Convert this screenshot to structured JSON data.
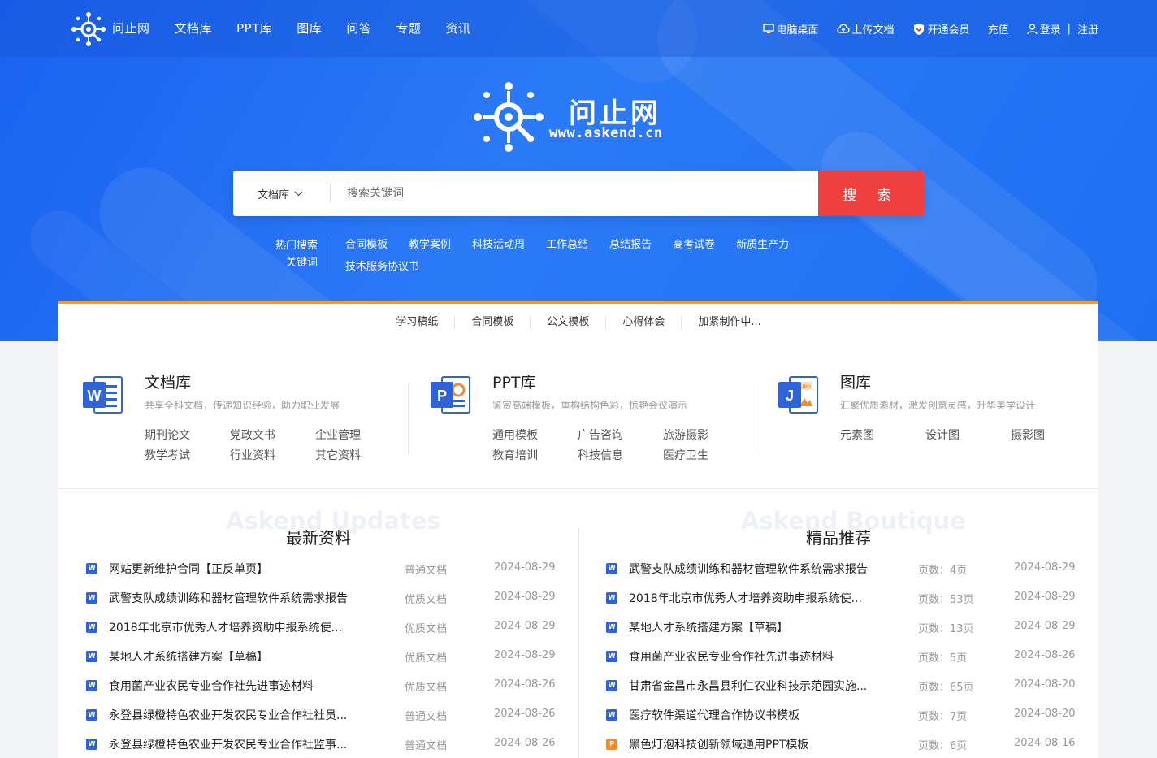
{
  "nav": {
    "brand": "问止网",
    "items": [
      "文档库",
      "PPT库",
      "图库",
      "问答",
      "专题",
      "资讯"
    ]
  },
  "top_right": {
    "desktop": "电脑桌面",
    "upload": "上传文档",
    "vip": "开通会员",
    "recharge": "充值",
    "login": "登录",
    "separator": "|",
    "register": "注册"
  },
  "brand": {
    "name": "问止网",
    "url": "www.askend.cn"
  },
  "search": {
    "scope": "文档库",
    "placeholder": "搜索关键词",
    "button": "搜 索"
  },
  "hot": {
    "label_line1": "热门搜索",
    "label_line2": "关键词",
    "keywords": [
      "合同模板",
      "教学案例",
      "科技活动周",
      "工作总结",
      "总结报告",
      "高考试卷",
      "新质生产力",
      "技术服务协议书"
    ]
  },
  "subtabs": [
    "学习稿纸",
    "合同模板",
    "公文模板",
    "心得体会",
    "加紧制作中..."
  ],
  "categories": [
    {
      "title": "文档库",
      "icon": "word-icon",
      "desc": "共享全科文档，传递知识经验，助力职业发展",
      "links": [
        "期刊论文",
        "党政文书",
        "企业管理",
        "教学考试",
        "行业资料",
        "其它资料"
      ]
    },
    {
      "title": "PPT库",
      "icon": "ppt-icon",
      "desc": "鉴赏高端模板，重构结构色彩，惊艳会议演示",
      "links": [
        "通用模板",
        "广告咨询",
        "旅游摄影",
        "教育培训",
        "科技信息",
        "医疗卫生"
      ]
    },
    {
      "title": "图库",
      "icon": "image-icon",
      "desc": "汇聚优质素材，激发创意灵感，升华美学设计",
      "links": [
        "元素图",
        "设计图",
        "摄影图"
      ]
    }
  ],
  "latest": {
    "title_bg": "Askend Updates",
    "title": "最新资料",
    "rows": [
      {
        "type": "W",
        "title": "网站更新维护合同【正反单页】",
        "kind": "普通文档",
        "date": "2024-08-29"
      },
      {
        "type": "W",
        "title": "武警支队成绩训练和器材管理软件系统需求报告",
        "kind": "优质文档",
        "date": "2024-08-29"
      },
      {
        "type": "W",
        "title": "2018年北京市优秀人才培养资助申报系统使...",
        "kind": "优质文档",
        "date": "2024-08-29"
      },
      {
        "type": "W",
        "title": "某地人才系统搭建方案【草稿】",
        "kind": "优质文档",
        "date": "2024-08-29"
      },
      {
        "type": "W",
        "title": "食用菌产业农民专业合作社先进事迹材料",
        "kind": "优质文档",
        "date": "2024-08-26"
      },
      {
        "type": "W",
        "title": "永登县绿橙特色农业开发农民专业合作社社员...",
        "kind": "普通文档",
        "date": "2024-08-26"
      },
      {
        "type": "W",
        "title": "永登县绿橙特色农业开发农民专业合作社监事...",
        "kind": "普通文档",
        "date": "2024-08-26"
      }
    ]
  },
  "boutique": {
    "title_bg": "Askend Boutique",
    "title": "精品推荐",
    "rows": [
      {
        "type": "W",
        "title": "武警支队成绩训练和器材管理软件系统需求报告",
        "pages": "页数：4页",
        "date": "2024-08-29"
      },
      {
        "type": "W",
        "title": "2018年北京市优秀人才培养资助申报系统使...",
        "pages": "页数：53页",
        "date": "2024-08-29"
      },
      {
        "type": "W",
        "title": "某地人才系统搭建方案【草稿】",
        "pages": "页数：13页",
        "date": "2024-08-29"
      },
      {
        "type": "W",
        "title": "食用菌产业农民专业合作社先进事迹材料",
        "pages": "页数：5页",
        "date": "2024-08-26"
      },
      {
        "type": "W",
        "title": "甘肃省金昌市永昌县利仁农业科技示范园实施...",
        "pages": "页数：65页",
        "date": "2024-08-20"
      },
      {
        "type": "W",
        "title": "医疗软件渠道代理合作协议书模板",
        "pages": "页数：7页",
        "date": "2024-08-20"
      },
      {
        "type": "P",
        "title": "黑色灯泡科技创新领域通用PPT模板",
        "pages": "页数：6页",
        "date": "2024-08-16"
      }
    ]
  },
  "colors": {
    "primary": "#1f6ff2",
    "search_button": "#ef3f3f",
    "tab_accent": "#f79a1e",
    "word": "#2f63d8",
    "ppt": "#f28b30"
  }
}
